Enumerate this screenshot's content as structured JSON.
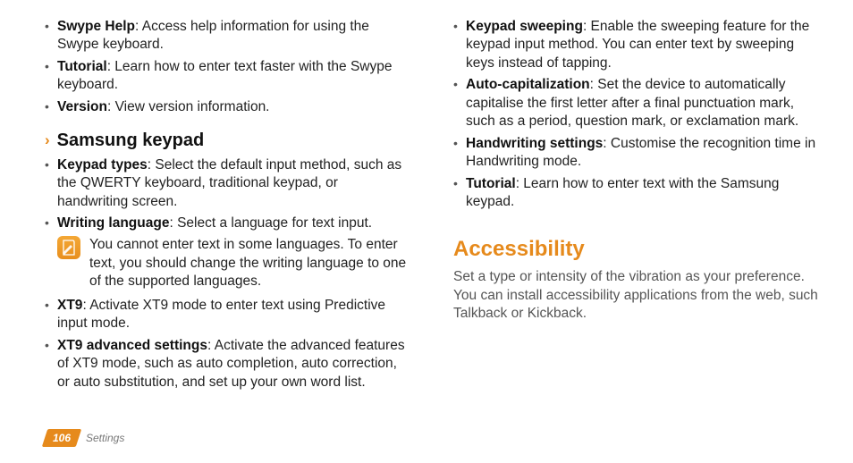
{
  "left": {
    "items_top": [
      {
        "term": "Swype Help",
        "desc": ": Access help information for using the Swype keyboard."
      },
      {
        "term": "Tutorial",
        "desc": ": Learn how to enter text faster with the Swype keyboard."
      },
      {
        "term": "Version",
        "desc": ": View version information."
      }
    ],
    "section_marker": "›",
    "section_title": "Samsung keypad",
    "items_mid": [
      {
        "term": "Keypad types",
        "desc": ": Select the default input method, such as the QWERTY keyboard, traditional keypad, or handwriting screen."
      },
      {
        "term": "Writing language",
        "desc": ": Select a language for text input."
      }
    ],
    "note": "You cannot enter text in some languages. To enter text, you should change the writing language to one of the supported languages.",
    "items_bottom": [
      {
        "term": "XT9",
        "desc": ": Activate XT9 mode to enter text using Predictive input mode."
      },
      {
        "term": "XT9 advanced settings",
        "desc": ": Activate the advanced features of XT9 mode, such as auto completion, auto correction, or auto substitution, and set up your own word list."
      }
    ]
  },
  "right": {
    "items": [
      {
        "term": "Keypad sweeping",
        "desc": ": Enable the sweeping feature for the keypad input method. You can enter text by  sweeping keys instead of tapping."
      },
      {
        "term": "Auto-capitalization",
        "desc": ": Set the device to automatically capitalise the first letter after a final punctuation mark, such as a period, question mark, or exclamation mark."
      },
      {
        "term": "Handwriting settings",
        "desc": ": Customise the recognition time in Handwriting mode."
      },
      {
        "term": "Tutorial",
        "desc": ": Learn how to enter text with the Samsung keypad."
      }
    ],
    "heading": "Accessibility",
    "desc": "Set a type or intensity of the vibration as your preference. You can install accessibility applications from the web, such Talkback or Kickback."
  },
  "footer": {
    "page": "106",
    "section": "Settings"
  }
}
